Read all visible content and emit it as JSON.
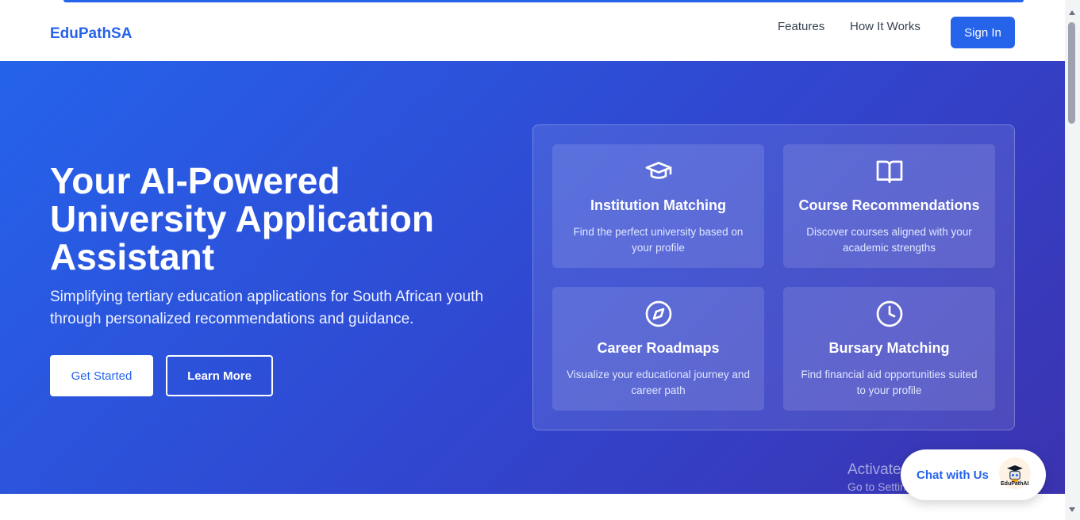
{
  "navbar": {
    "brand": "EduPathSA",
    "links": [
      "Features",
      "How It Works"
    ],
    "signin_label": "Sign In"
  },
  "hero": {
    "title": "Your AI-Powered University Application Assistant",
    "subtitle": "Simplifying tertiary education applications for South African youth through personalized recommendations and guidance.",
    "primary_button": "Get Started",
    "secondary_button": "Learn More"
  },
  "features": [
    {
      "icon": "graduation-cap-icon",
      "title": "Institution Matching",
      "description": "Find the perfect university based on your profile"
    },
    {
      "icon": "book-open-icon",
      "title": "Course Recommendations",
      "description": "Discover courses aligned with your academic strengths"
    },
    {
      "icon": "compass-icon",
      "title": "Career Roadmaps",
      "description": "Visualize your educational journey and career path"
    },
    {
      "icon": "clock-icon",
      "title": "Bursary Matching",
      "description": "Find financial aid opportunities suited to your profile"
    }
  ],
  "chat_widget": {
    "label": "Chat with Us",
    "avatar_caption": "EduPathAI"
  },
  "watermark": {
    "line1": "Activate Windows",
    "line2": "Go to Settings to activate Windows."
  },
  "colors": {
    "brand": "#2563eb",
    "hero_start": "#2563eb",
    "hero_end": "#3b33b0"
  }
}
